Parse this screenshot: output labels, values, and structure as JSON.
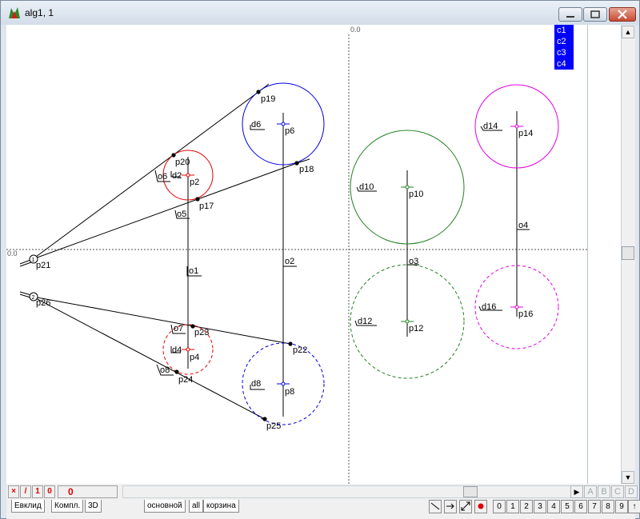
{
  "window": {
    "title": "alg1, 1"
  },
  "axis": {
    "x_zero_label": "0.0",
    "y_zero_label": "0.0"
  },
  "legend": [
    "c1",
    "c2",
    "c3",
    "c4"
  ],
  "points": {
    "p2": "p2",
    "p4": "p4",
    "p6": "p6",
    "p8": "p8",
    "p10": "p10",
    "p12": "p12",
    "p14": "p14",
    "p16": "p16",
    "p17": "p17",
    "p18": "p18",
    "p19": "p19",
    "p20": "p20",
    "p21": "p21",
    "p22": "p22",
    "p23": "p23",
    "p24": "p24",
    "p25": "p25",
    "p26": "p26"
  },
  "circles": {
    "d2": "d2",
    "d4": "d4",
    "d6": "d6",
    "d8": "d8",
    "d10": "d10",
    "d12": "d12",
    "d14": "d14",
    "d16": "d16"
  },
  "lines": {
    "o1": "o1",
    "o2": "o2",
    "o3": "o3",
    "o4": "o4",
    "o5": "o5",
    "o6": "o6",
    "o7": "o7",
    "o8": "o8"
  },
  "markers": {
    "m1": "1",
    "m2": "2"
  },
  "bottom": {
    "ctrl_x": "×",
    "ctrl_slash": "/",
    "ctrl_1": "1",
    "ctrl_0": "0",
    "ctrl_big0": "0",
    "tabs": [
      "Евклид",
      "Компл.",
      "3D",
      "основной",
      "all",
      "корзина"
    ],
    "abcd": [
      "A",
      "B",
      "C",
      "D"
    ],
    "numbers": [
      "0",
      "1",
      "2",
      "3",
      "4",
      "5",
      "6",
      "7",
      "8",
      "9"
    ],
    "up_arrow": "↑"
  },
  "colors": {
    "red": "#e00000",
    "blue": "#0000e0",
    "green": "#208020",
    "magenta": "#e000e0",
    "legend_bg": "#0000ff"
  }
}
